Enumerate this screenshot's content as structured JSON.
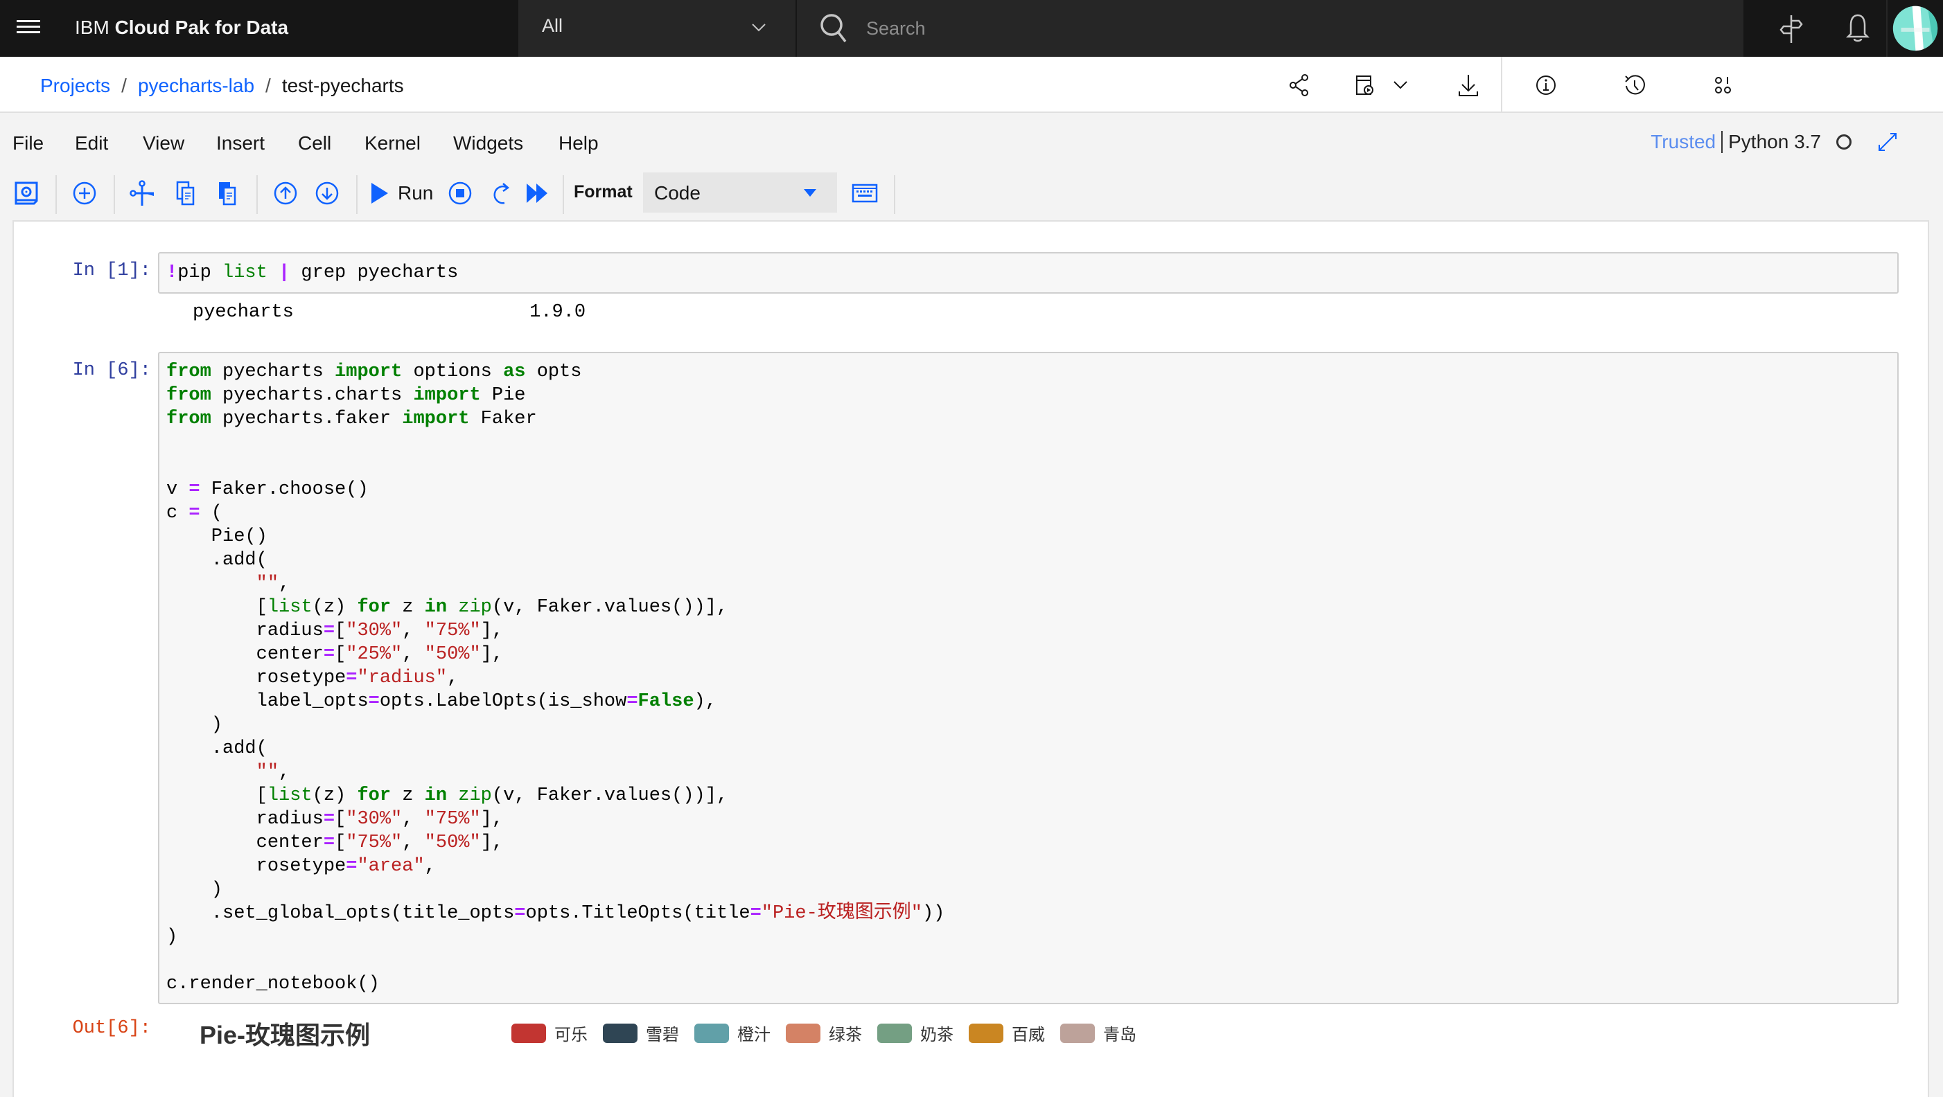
{
  "topbar": {
    "brand_prefix": "IBM",
    "brand_name": "Cloud Pak for Data",
    "scope_value": "All",
    "search_placeholder": "Search"
  },
  "breadcrumb": {
    "items": [
      "Projects",
      "pyecharts-lab"
    ],
    "current": "test-pyecharts",
    "separator": "/"
  },
  "menu": {
    "items": [
      "File",
      "Edit",
      "View",
      "Insert",
      "Cell",
      "Kernel",
      "Widgets",
      "Help"
    ]
  },
  "kernel": {
    "trusted_label": "Trusted",
    "name": "Python 3.7"
  },
  "toolbar": {
    "run_label": "Run",
    "format_label": "Format",
    "format_value": "Code"
  },
  "cells": [
    {
      "prompt": "In [1]:",
      "output_text": "pyecharts                     1.9.0"
    },
    {
      "prompt": "In [6]:",
      "out_prompt": "Out[6]:"
    }
  ],
  "chart_data": {
    "type": "pie",
    "title": "Pie-玫瑰图示例",
    "legend_position": "top",
    "categories": [
      "可乐",
      "雪碧",
      "橙汁",
      "绿茶",
      "奶茶",
      "百威",
      "青岛"
    ],
    "colors": [
      "#c23531",
      "#2f4554",
      "#61a0a8",
      "#d48265",
      "#749f83",
      "#ca8622",
      "#bda29a"
    ],
    "values": [],
    "series": [
      {
        "name": "",
        "rosetype": "radius",
        "radius": [
          "30%",
          "75%"
        ],
        "center": [
          "25%",
          "50%"
        ]
      },
      {
        "name": "",
        "rosetype": "area",
        "radius": [
          "30%",
          "75%"
        ],
        "center": [
          "75%",
          "50%"
        ]
      }
    ]
  }
}
